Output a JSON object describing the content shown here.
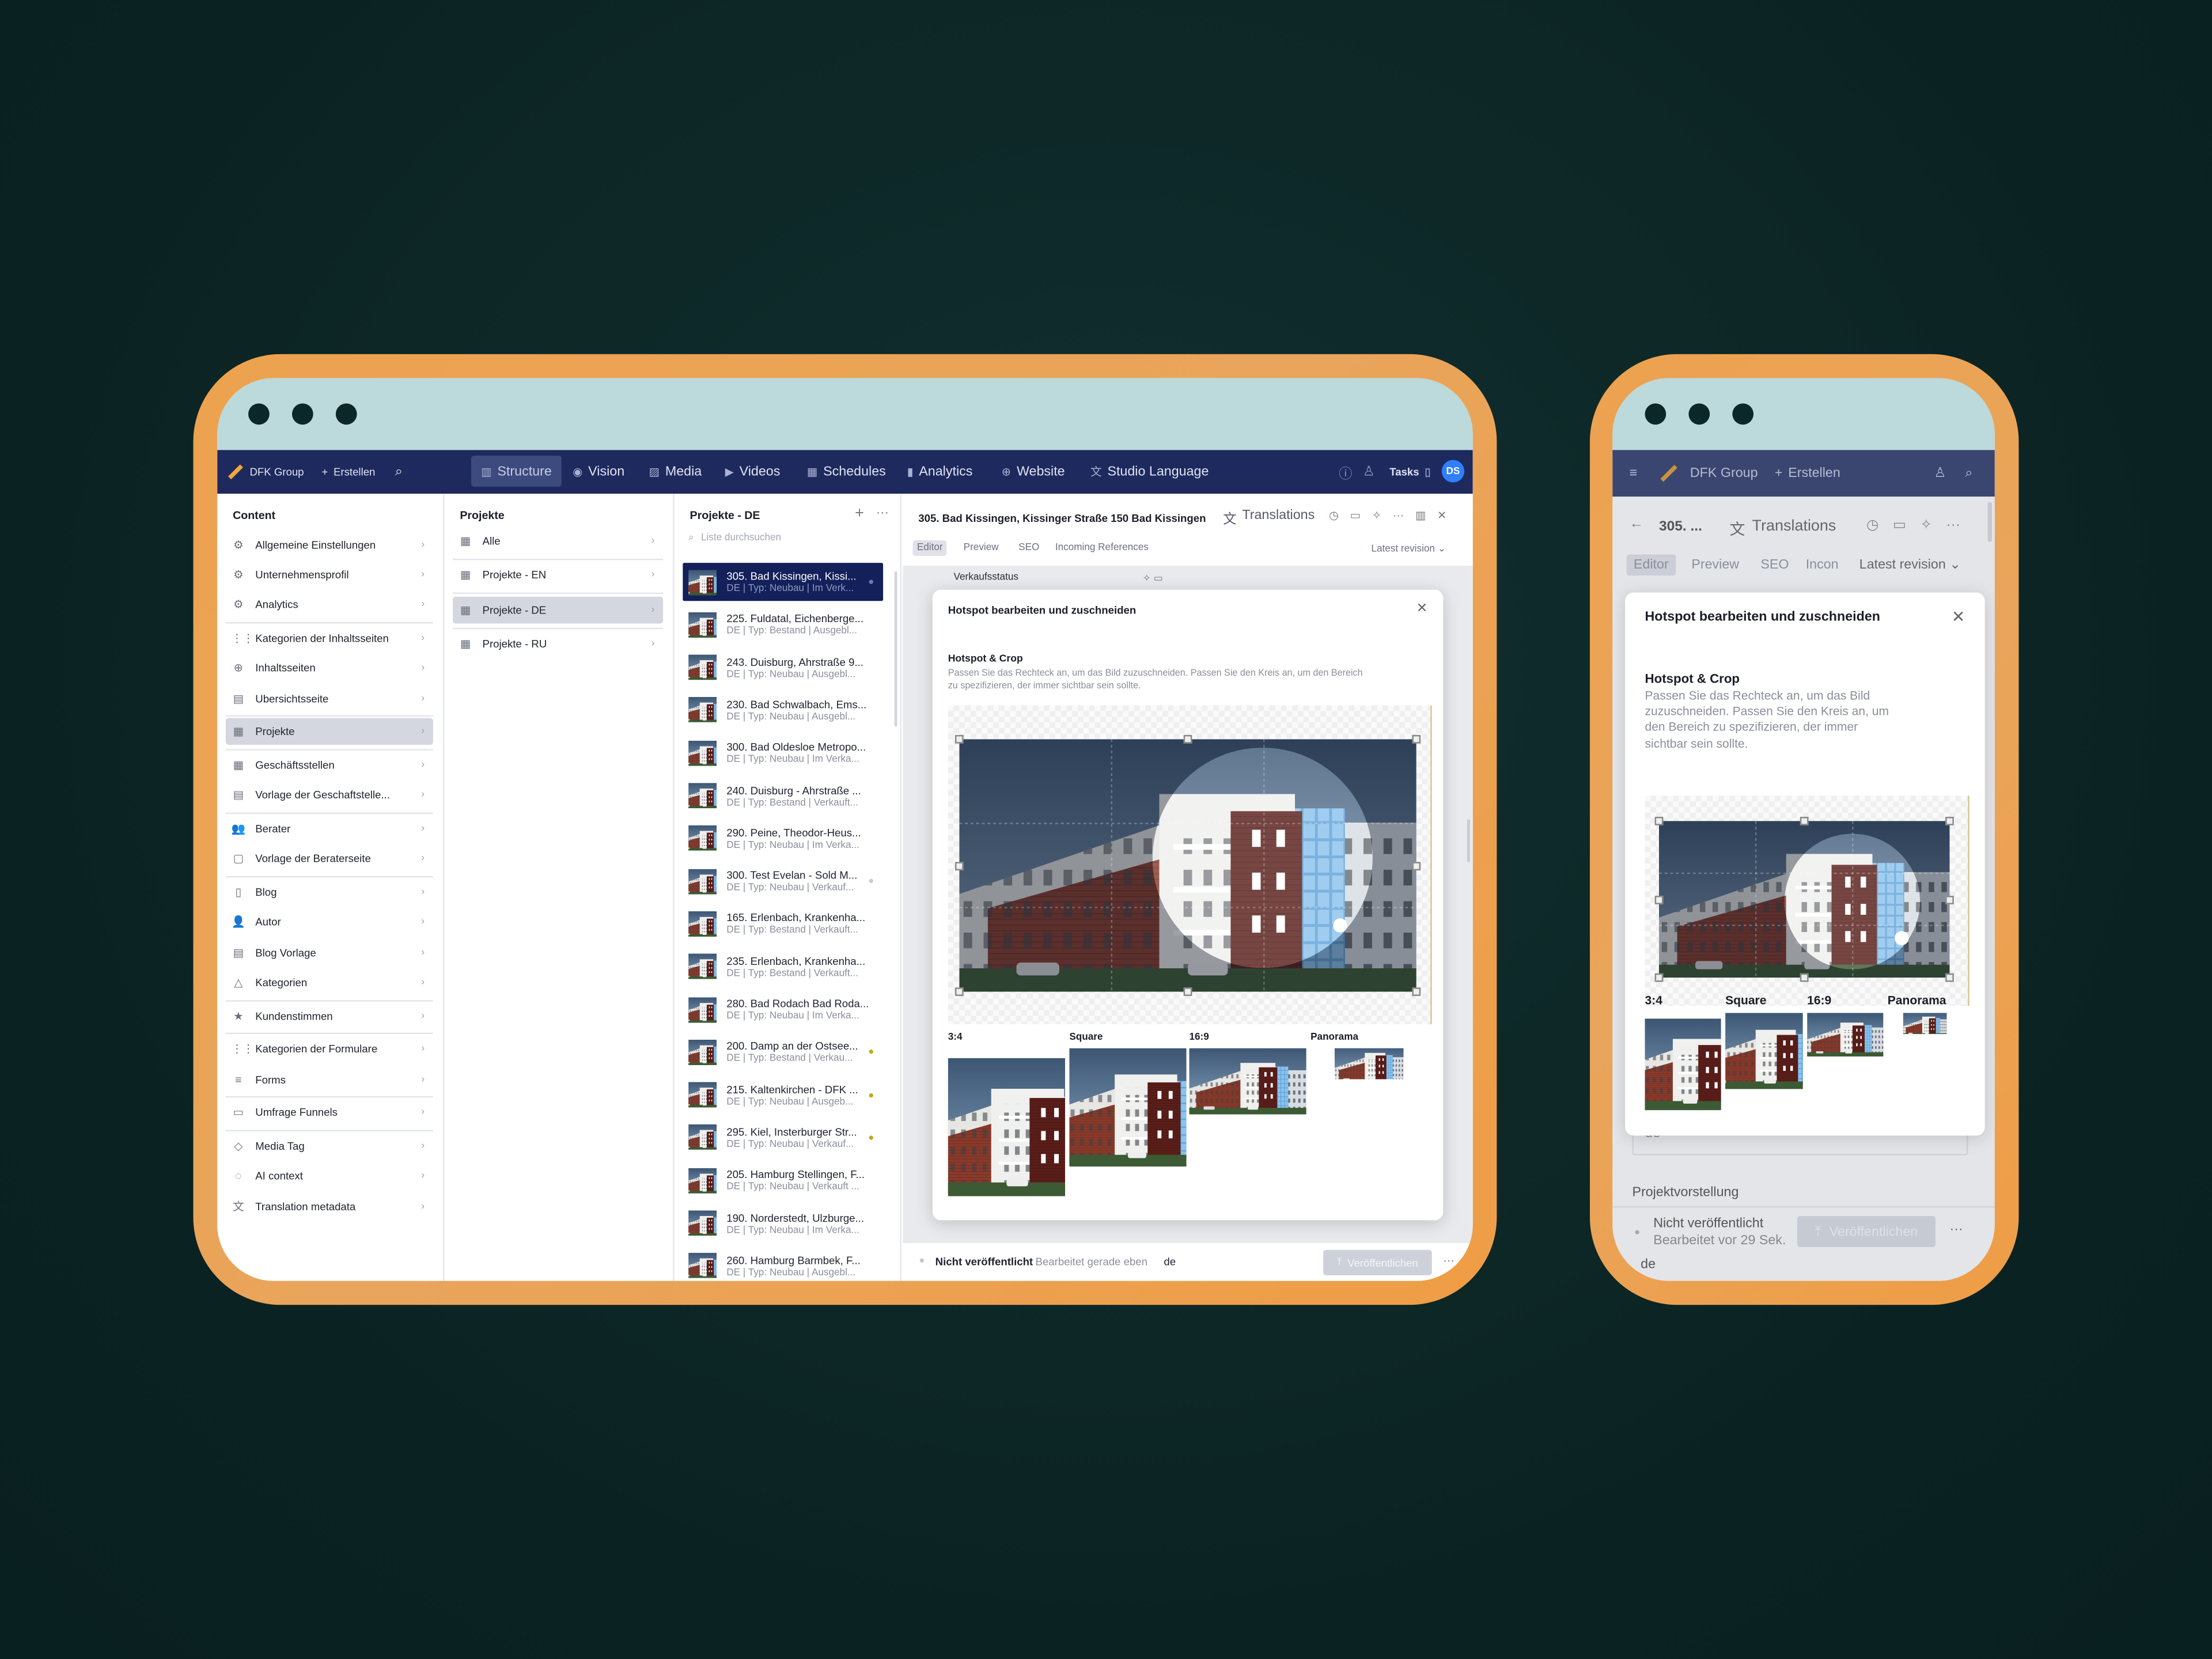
{
  "colors": {
    "frame": "#eda24e",
    "nav": "#1e2a5d",
    "selected": "#13205a",
    "avatar": "#2f7fff",
    "background": "#0c2424",
    "status_dot": "#c4a81a"
  },
  "desktop": {
    "nav": {
      "brand": "DFK Group",
      "create": "Erstellen",
      "search_icon": "search-icon",
      "tools": [
        {
          "label": "Structure",
          "icon": "structure-icon",
          "active": true
        },
        {
          "label": "Vision",
          "icon": "eye-icon"
        },
        {
          "label": "Media",
          "icon": "image-icon"
        },
        {
          "label": "Videos",
          "icon": "video-icon"
        },
        {
          "label": "Schedules",
          "icon": "calendar-icon"
        },
        {
          "label": "Analytics",
          "icon": "chart-icon"
        },
        {
          "label": "Website",
          "icon": "globe-icon"
        },
        {
          "label": "Studio Language",
          "icon": "translate-icon"
        }
      ],
      "tasks": "Tasks",
      "avatar": "DS"
    },
    "content": {
      "title": "Content",
      "items": [
        {
          "label": "Allgemeine Einstellungen",
          "icon": "⚙"
        },
        {
          "label": "Unternehmensprofil",
          "icon": "⚙"
        },
        {
          "label": "Analytics",
          "icon": "⚙",
          "divider": true
        },
        {
          "label": "Kategorien der Inhaltsseiten",
          "icon": "⋮⋮"
        },
        {
          "label": "Inhaltsseiten",
          "icon": "⊕"
        },
        {
          "label": "Ubersichtsseite",
          "icon": "▤",
          "divider": true
        },
        {
          "label": "Projekte",
          "icon": "▦",
          "selected": true,
          "divider": true
        },
        {
          "label": "Geschäftsstellen",
          "icon": "▦"
        },
        {
          "label": "Vorlage der Geschaftstelle...",
          "icon": "▤",
          "divider": true
        },
        {
          "label": "Berater",
          "icon": "👥"
        },
        {
          "label": "Vorlage der Beraterseite",
          "icon": "▢",
          "divider": true
        },
        {
          "label": "Blog",
          "icon": "▯"
        },
        {
          "label": "Autor",
          "icon": "👤"
        },
        {
          "label": "Blog Vorlage",
          "icon": "▤"
        },
        {
          "label": "Kategorien",
          "icon": "△",
          "divider": true
        },
        {
          "label": "Kundenstimmen",
          "icon": "★",
          "divider": true
        },
        {
          "label": "Kategorien der Formulare",
          "icon": "⋮⋮"
        },
        {
          "label": "Forms",
          "icon": "≡",
          "divider": true
        },
        {
          "label": "Umfrage Funnels",
          "icon": "▭",
          "divider": true
        },
        {
          "label": "Media Tag",
          "icon": "◇"
        },
        {
          "label": "AI context",
          "icon": "◌"
        },
        {
          "label": "Translation metadata",
          "icon": "文"
        }
      ]
    },
    "projekte": {
      "title": "Projekte",
      "items": [
        {
          "label": "Alle"
        },
        {
          "label": "Projekte - EN"
        },
        {
          "label": "Projekte - DE",
          "selected": true
        },
        {
          "label": "Projekte - RU"
        }
      ]
    },
    "list": {
      "title": "Projekte - DE",
      "search_placeholder": "Liste durchsuchen",
      "items": [
        {
          "title": "305. Bad Kissingen, Kissi...",
          "sub": "DE | Typ: Neubau | Im Verk...",
          "selected": true,
          "dot": "#6f7aa8"
        },
        {
          "title": "225. Fuldatal, Eichenberge...",
          "sub": "DE | Typ: Bestand | Ausgebl..."
        },
        {
          "title": "243. Duisburg, Ahrstraße 9...",
          "sub": "DE | Typ: Neubau | Ausgebl..."
        },
        {
          "title": "230. Bad Schwalbach, Ems...",
          "sub": "DE | Typ: Neubau | Ausgebl..."
        },
        {
          "title": "300. Bad Oldesloe Metropo...",
          "sub": "DE | Typ: Neubau | Im Verka..."
        },
        {
          "title": "240. Duisburg - Ahrstraße ...",
          "sub": "DE | Typ: Bestand | Verkauft..."
        },
        {
          "title": "290. Peine, Theodor-Heus...",
          "sub": "DE | Typ: Neubau | Im Verka..."
        },
        {
          "title": "300. Test Evelan - Sold M...",
          "sub": "DE | Typ: Neubau | Verkauf...",
          "dot": "#c8ccd4"
        },
        {
          "title": "165. Erlenbach, Krankenha...",
          "sub": "DE | Typ: Bestand | Verkauft..."
        },
        {
          "title": "235. Erlenbach, Krankenha...",
          "sub": "DE | Typ: Bestand | Verkauft..."
        },
        {
          "title": "280. Bad Rodach Bad Roda...",
          "sub": "DE | Typ: Neubau | Im Verka..."
        },
        {
          "title": "200. Damp an der Ostsee...",
          "sub": "DE | Typ: Bestand | Verkau...",
          "dot": "#c4a81a"
        },
        {
          "title": "215. Kaltenkirchen - DFK ...",
          "sub": "DE | Typ: Neubau | Ausgeb...",
          "dot": "#c4a81a"
        },
        {
          "title": "295. Kiel, Insterburger Str...",
          "sub": "DE | Typ: Neubau | Verkauf...",
          "dot": "#c4a81a"
        },
        {
          "title": "205. Hamburg Stellingen, F...",
          "sub": "DE | Typ: Neubau | Verkauft ..."
        },
        {
          "title": "190. Norderstedt, Ulzburge...",
          "sub": "DE | Typ: Neubau | Im Verka..."
        },
        {
          "title": "260. Hamburg Barmbek, F...",
          "sub": "DE | Typ: Neubau | Ausgebl..."
        }
      ]
    },
    "editor": {
      "title": "305. Bad Kissingen, Kissinger Straße 150 Bad Kissingen",
      "translations": "Translations",
      "tabs": [
        "Editor",
        "Preview",
        "SEO",
        "Incoming References"
      ],
      "revision": "Latest revision",
      "field": "Verkaufsstatus",
      "status": "Nicht veröffentlicht",
      "edited": "Bearbeitet gerade eben",
      "lang": "de",
      "publish": "Veröffentlichen"
    }
  },
  "modal": {
    "title": "Hotspot bearbeiten und zuschneiden",
    "section": "Hotspot & Crop",
    "description": "Passen Sie das Rechteck an, um das Bild zuzuschneiden. Passen Sie den Kreis an, um den Bereich zu spezifizieren, der immer sichtbar sein sollte.",
    "previews": [
      "3:4",
      "Square",
      "16:9",
      "Panorama"
    ]
  },
  "mobile": {
    "brand": "DFK Group",
    "create": "Erstellen",
    "title": "305. ...",
    "translations": "Translations",
    "tabs": [
      "Editor",
      "Preview",
      "SEO",
      "Incon"
    ],
    "revision": "Latest revision",
    "field_value": "de",
    "section": "Projektvorstellung",
    "status": "Nicht veröffentlicht",
    "edited": "Bearbeitet vor 29 Sek.",
    "publish": "Veröffentlichen",
    "lang": "de"
  }
}
